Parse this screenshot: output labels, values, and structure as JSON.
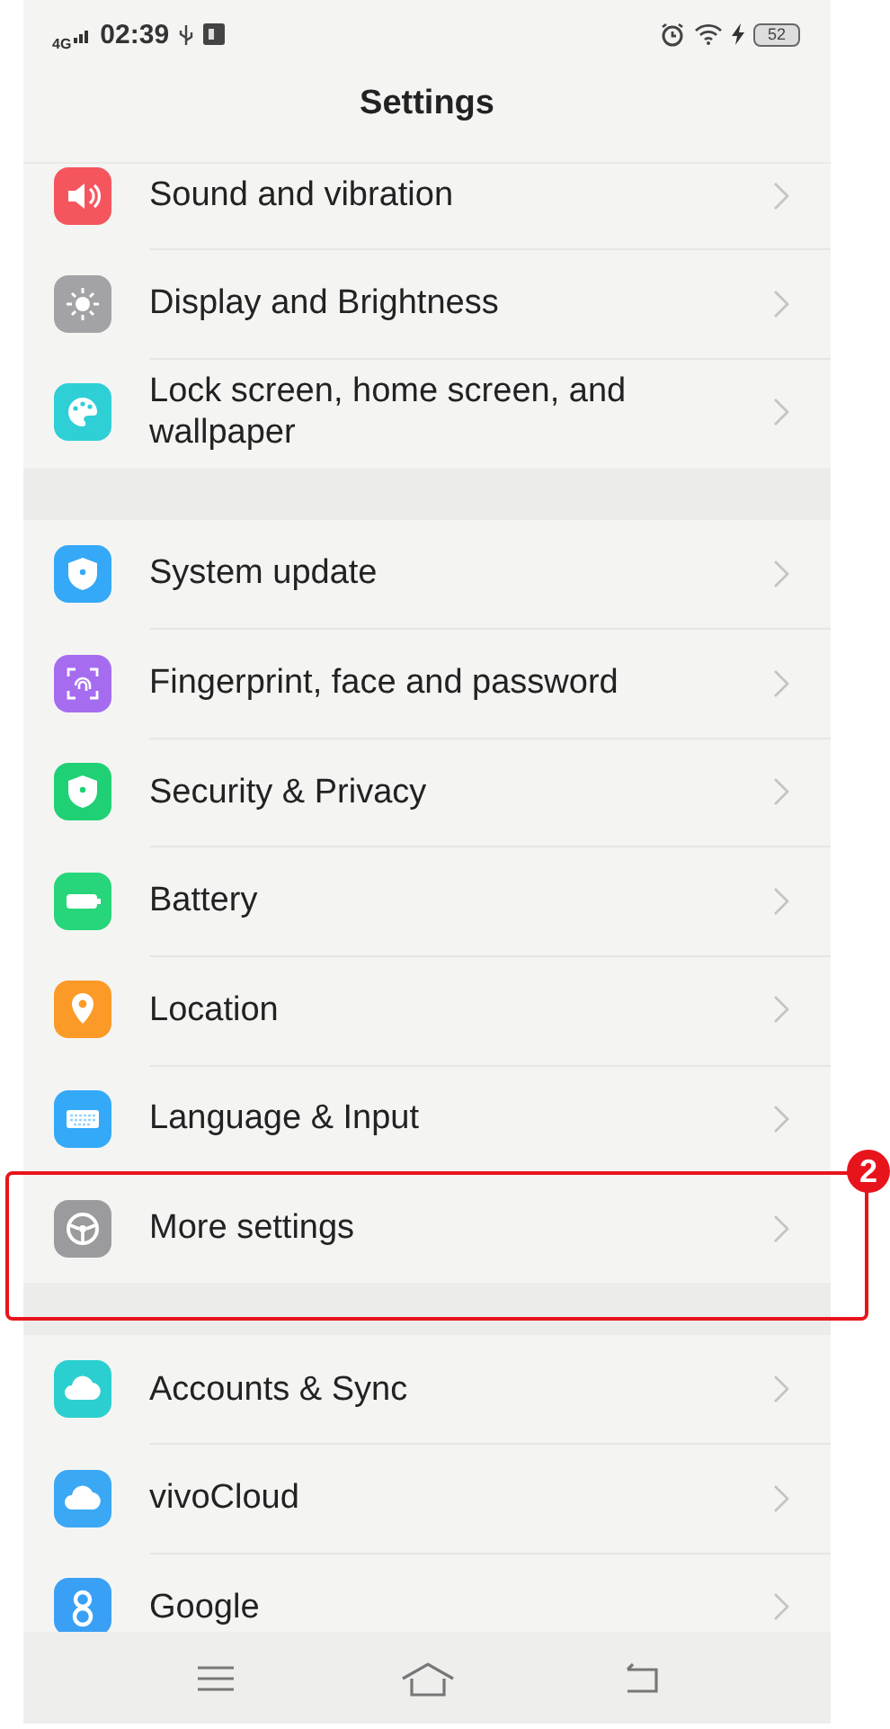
{
  "status_bar": {
    "network": "4G",
    "time": "02:39",
    "battery": "52"
  },
  "title": "Settings",
  "groups": [
    {
      "items": [
        {
          "label": "Sound and vibration",
          "color": "#f5565e",
          "annotated": false
        },
        {
          "label": "Display and Brightness",
          "color": "#a3a3a5",
          "annotated": false
        },
        {
          "label": "Lock screen, home screen, and wallpaper",
          "color": "#2fcfd6",
          "annotated": false
        }
      ]
    },
    {
      "items": [
        {
          "label": "System update",
          "color": "#35a8f7",
          "annotated": false
        },
        {
          "label": "Fingerprint, face and password",
          "color": "#a66cf0",
          "annotated": false
        },
        {
          "label": "Security & Privacy",
          "color": "#1fd174",
          "annotated": false
        },
        {
          "label": "Battery",
          "color": "#27d67a",
          "annotated": false
        },
        {
          "label": "Location",
          "color": "#fb9a26",
          "annotated": false
        },
        {
          "label": "Language & Input",
          "color": "#34a9f8",
          "annotated": false
        },
        {
          "label": "More settings",
          "color": "#9b9b9d",
          "annotated": true
        }
      ]
    },
    {
      "items": [
        {
          "label": "Accounts & Sync",
          "color": "#2ccfcf",
          "annotated": false
        },
        {
          "label": "vivoCloud",
          "color": "#3aa8f5",
          "annotated": false
        },
        {
          "label": "Google",
          "color": "#3aa0f5",
          "annotated": false
        }
      ]
    }
  ],
  "annotation": {
    "badge": "2"
  }
}
